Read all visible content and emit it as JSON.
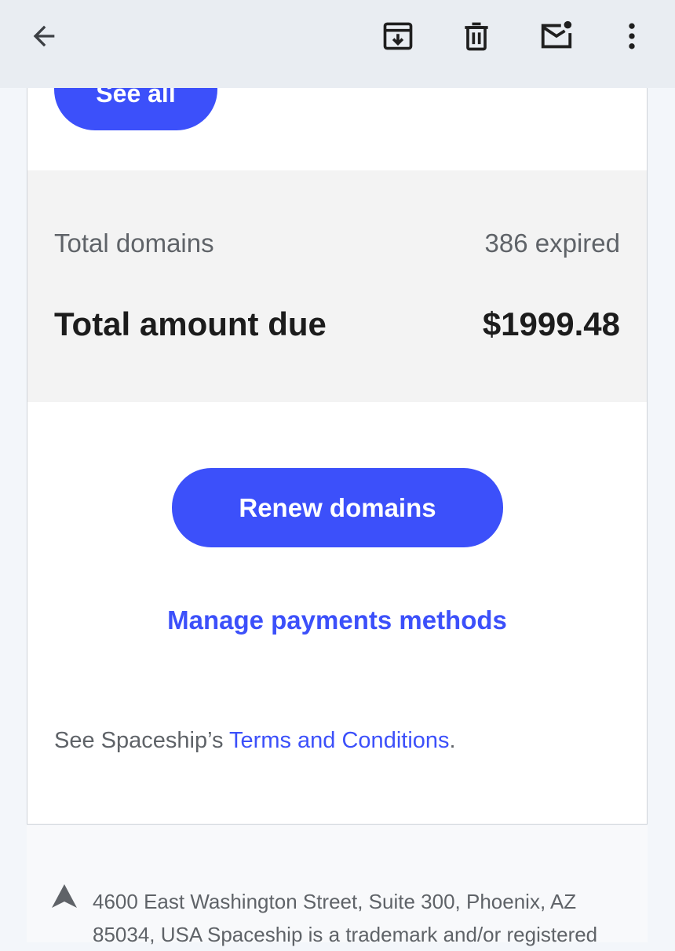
{
  "toolbar": {
    "back_icon": "arrow-left-icon",
    "archive_icon": "archive-icon",
    "delete_icon": "trash-icon",
    "mark_unread_icon": "mail-unread-icon",
    "more_icon": "more-vert-icon"
  },
  "email": {
    "see_all_label": "See all",
    "summary": {
      "total_domains_label": "Total domains",
      "total_domains_value": "386 expired",
      "amount_due_label": "Total amount due",
      "amount_due_value": "$1999.48"
    },
    "renew_button_label": "Renew domains",
    "manage_payments_label": "Manage payments methods",
    "terms": {
      "prefix": "See Spaceship’s ",
      "link_label": "Terms and Conditions",
      "suffix": "."
    },
    "footer": {
      "logo_icon": "spaceship-logo-icon",
      "text": "4600 East Washington Street, Suite 300, Phoenix, AZ 85034, USA Spaceship is a trademark and/or registered"
    }
  },
  "colors": {
    "accent": "#3c50fa",
    "top_bar": "#e9edf2",
    "summary_bg": "#f3f3f3",
    "muted_text": "#5f6368",
    "dark_text": "#1c1c1c"
  }
}
